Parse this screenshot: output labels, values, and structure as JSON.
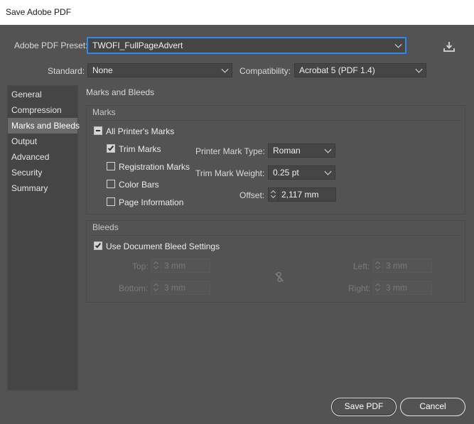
{
  "window": {
    "title": "Save Adobe PDF"
  },
  "preset": {
    "label": "Adobe PDF Preset:",
    "value": "TWOFI_FullPageAdvert"
  },
  "standard": {
    "label": "Standard:",
    "value": "None"
  },
  "compatibility": {
    "label": "Compatibility:",
    "value": "Acrobat 5 (PDF 1.4)"
  },
  "sidebar": {
    "items": [
      {
        "label": "General"
      },
      {
        "label": "Compression"
      },
      {
        "label": "Marks and Bleeds"
      },
      {
        "label": "Output"
      },
      {
        "label": "Advanced"
      },
      {
        "label": "Security"
      },
      {
        "label": "Summary"
      }
    ],
    "active": "Marks and Bleeds"
  },
  "main": {
    "section_title": "Marks and Bleeds",
    "marks": {
      "heading": "Marks",
      "all_printers_marks": "All Printer's Marks",
      "trim_marks": "Trim Marks",
      "registration_marks": "Registration Marks",
      "color_bars": "Color Bars",
      "page_information": "Page Information",
      "printer_mark_type_label": "Printer Mark Type:",
      "printer_mark_type_value": "Roman",
      "trim_mark_weight_label": "Trim Mark Weight:",
      "trim_mark_weight_value": "0.25 pt",
      "offset_label": "Offset:",
      "offset_value": "2,117 mm"
    },
    "bleeds": {
      "heading": "Bleeds",
      "use_document_bleed": "Use Document Bleed Settings",
      "top_label": "Top:",
      "top_value": "3 mm",
      "bottom_label": "Bottom:",
      "bottom_value": "3 mm",
      "left_label": "Left:",
      "left_value": "3 mm",
      "right_label": "Right:",
      "right_value": "3 mm"
    }
  },
  "buttons": {
    "save": "Save PDF",
    "cancel": "Cancel"
  }
}
